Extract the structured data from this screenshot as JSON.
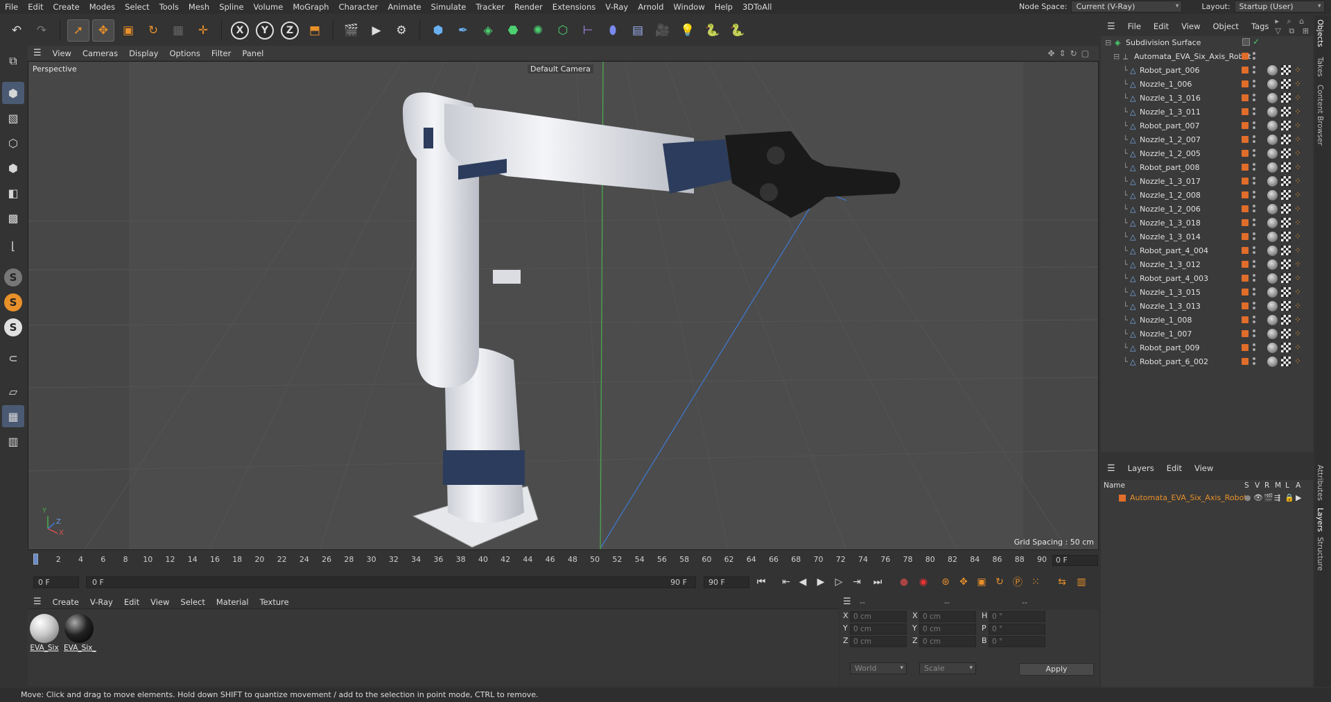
{
  "menubar": {
    "items": [
      "File",
      "Edit",
      "Create",
      "Modes",
      "Select",
      "Tools",
      "Mesh",
      "Spline",
      "Volume",
      "MoGraph",
      "Character",
      "Animate",
      "Simulate",
      "Tracker",
      "Render",
      "Extensions",
      "V-Ray",
      "Arnold",
      "Window",
      "Help",
      "3DToAll"
    ],
    "node_space_label": "Node Space:",
    "node_space_value": "Current (V-Ray)",
    "layout_label": "Layout:",
    "layout_value": "Startup (User)"
  },
  "toolbar": {
    "axis_x": "X",
    "axis_y": "Y",
    "axis_z": "Z"
  },
  "left_tools": {
    "s1": "S",
    "s2": "S",
    "s3": "S"
  },
  "viewport": {
    "menu": [
      "View",
      "Cameras",
      "Display",
      "Options",
      "Filter",
      "Panel"
    ],
    "label": "Perspective",
    "camera": "Default Camera",
    "grid_spacing": "Grid Spacing : 50 cm",
    "axis_y": "Y",
    "axis_z": "Z",
    "axis_x": "X"
  },
  "timeline": {
    "ticks": [
      "0",
      "2",
      "4",
      "6",
      "8",
      "10",
      "12",
      "14",
      "16",
      "18",
      "20",
      "22",
      "24",
      "26",
      "28",
      "30",
      "32",
      "34",
      "36",
      "38",
      "40",
      "42",
      "44",
      "46",
      "48",
      "50",
      "52",
      "54",
      "56",
      "58",
      "60",
      "62",
      "64",
      "66",
      "68",
      "70",
      "72",
      "74",
      "76",
      "78",
      "80",
      "82",
      "84",
      "86",
      "88",
      "90"
    ],
    "current_frame": "0 F",
    "start_field": "0 F",
    "range_start": "0 F",
    "range_end": "90 F",
    "end_field": "90 F"
  },
  "materials": {
    "menu": [
      "Create",
      "V-Ray",
      "Edit",
      "View",
      "Select",
      "Material",
      "Texture"
    ],
    "items": [
      {
        "label": "EVA_Six",
        "color": "#d8d8d8"
      },
      {
        "label": "EVA_Six_",
        "color": "#1a1a1a"
      }
    ]
  },
  "coords": {
    "head1": "--",
    "head2": "--",
    "head3": "--",
    "rows": [
      {
        "a": "X",
        "av": "0 cm",
        "b": "X",
        "bv": "0 cm",
        "c": "H",
        "cv": "0 °"
      },
      {
        "a": "Y",
        "av": "0 cm",
        "b": "Y",
        "bv": "0 cm",
        "c": "P",
        "cv": "0 °"
      },
      {
        "a": "Z",
        "av": "0 cm",
        "b": "Z",
        "bv": "0 cm",
        "c": "B",
        "cv": "0 °"
      }
    ],
    "mode1": "World",
    "mode2": "Scale",
    "apply": "Apply"
  },
  "status": "Move: Click and drag to move elements. Hold down SHIFT to quantize movement / add to the selection in point mode, CTRL to remove.",
  "objects": {
    "menu": [
      "File",
      "Edit",
      "View",
      "Object",
      "Tags"
    ],
    "root1": "Subdivision Surface",
    "root2": "Automata_EVA_Six_Axis_Robot",
    "children": [
      "Robot_part_006",
      "Nozzle_1_006",
      "Nozzle_1_3_016",
      "Nozzle_1_3_011",
      "Robot_part_007",
      "Nozzle_1_2_007",
      "Nozzle_1_2_005",
      "Robot_part_008",
      "Nozzle_1_3_017",
      "Nozzle_1_2_008",
      "Nozzle_1_2_006",
      "Nozzle_1_3_018",
      "Nozzle_1_3_014",
      "Robot_part_4_004",
      "Nozzle_1_3_012",
      "Robot_part_4_003",
      "Nozzle_1_3_015",
      "Nozzle_1_3_013",
      "Nozzle_1_008",
      "Nozzle_1_007",
      "Robot_part_009",
      "Robot_part_6_002"
    ]
  },
  "layers": {
    "menu": [
      "Layers",
      "Edit",
      "View"
    ],
    "col_name": "Name",
    "cols": [
      "S",
      "V",
      "R",
      "M",
      "L",
      "A"
    ],
    "items": [
      "Automata_EVA_Six_Axis_Robot"
    ]
  },
  "right_tabs": [
    "Objects",
    "Takes",
    "Content Browser",
    "Attributes",
    "Layers",
    "Structure"
  ],
  "colors": {
    "accent": "#e8902a",
    "layer": "#e06d2a",
    "link": "#e8902a"
  }
}
